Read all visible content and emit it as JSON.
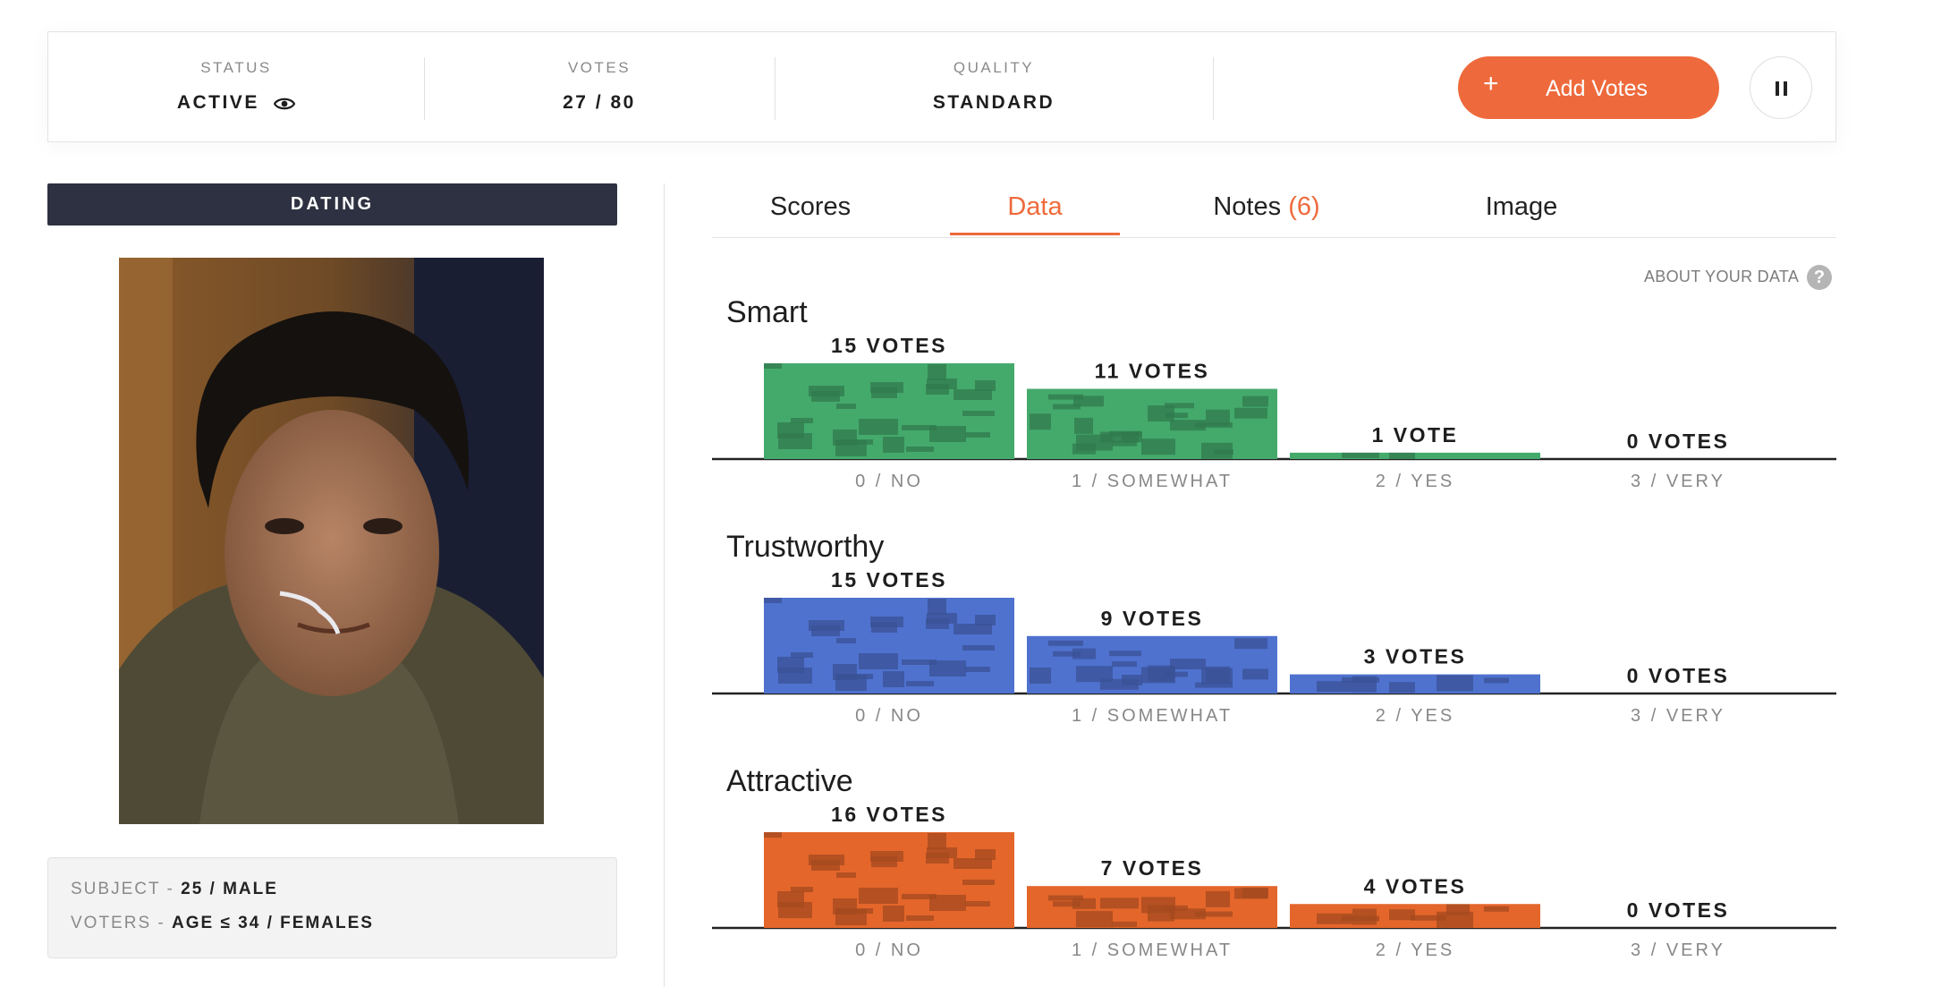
{
  "status_bar": {
    "status": {
      "label": "STATUS",
      "value": "ACTIVE"
    },
    "votes": {
      "label": "VOTES",
      "value": "27 / 80"
    },
    "quality": {
      "label": "QUALITY",
      "value": "STANDARD"
    },
    "add_votes": {
      "icon": "+",
      "label": "Add Votes"
    },
    "pause_icon": "pause-icon"
  },
  "profile": {
    "category": "DATING",
    "subject_label": "SUBJECT",
    "subject_value": "25 / MALE",
    "voters_label": "VOTERS",
    "voters_value": "AGE ≤ 34 / FEMALES"
  },
  "tabs": {
    "scores": "Scores",
    "data": "Data",
    "notes": "Notes",
    "notes_count": "(6)",
    "image": "Image",
    "active": "Data"
  },
  "about": {
    "label": "ABOUT YOUR DATA",
    "icon": "?"
  },
  "colors": {
    "accent": "#ee6a3c",
    "smart": "#44aa6c",
    "trustworthy": "#4f72cf",
    "attractive": "#e4662b"
  },
  "chart_data": [
    {
      "type": "bar",
      "title": "Smart",
      "categories": [
        "0 / NO",
        "1 / SOMEWHAT",
        "2 / YES",
        "3 / VERY"
      ],
      "values": [
        15,
        11,
        1,
        0
      ],
      "value_labels": [
        "15 VOTES",
        "11 VOTES",
        "1 VOTE",
        "0 VOTES"
      ],
      "color": "#44aa6c",
      "ylim": [
        0,
        15
      ]
    },
    {
      "type": "bar",
      "title": "Trustworthy",
      "categories": [
        "0 / NO",
        "1 / SOMEWHAT",
        "2 / YES",
        "3 / VERY"
      ],
      "values": [
        15,
        9,
        3,
        0
      ],
      "value_labels": [
        "15 VOTES",
        "9 VOTES",
        "3 VOTES",
        "0 VOTES"
      ],
      "color": "#4f72cf",
      "ylim": [
        0,
        15
      ]
    },
    {
      "type": "bar",
      "title": "Attractive",
      "categories": [
        "0 / NO",
        "1 / SOMEWHAT",
        "2 / YES",
        "3 / VERY"
      ],
      "values": [
        16,
        7,
        4,
        0
      ],
      "value_labels": [
        "16 VOTES",
        "7 VOTES",
        "4 VOTES",
        "0 VOTES"
      ],
      "color": "#e4662b",
      "ylim": [
        0,
        16
      ]
    }
  ]
}
